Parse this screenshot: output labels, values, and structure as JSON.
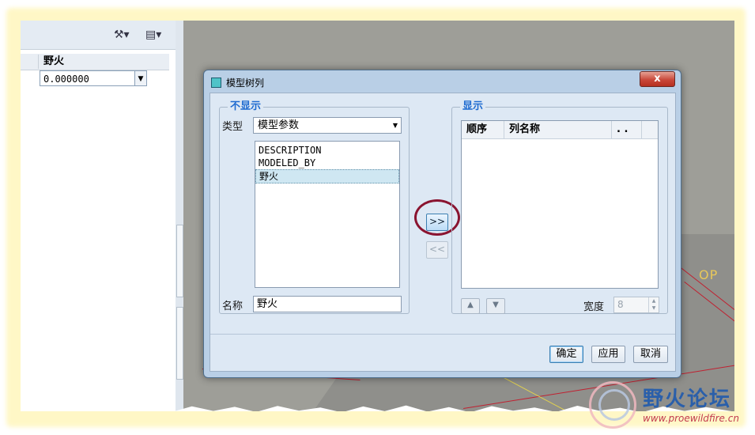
{
  "left_panel": {
    "column_header": "野火",
    "cell_value": "0.000000",
    "tools_icon": "tools-icon",
    "list_icon": "list-settings-icon"
  },
  "dialog": {
    "title": "模型树列",
    "close_label": "x",
    "not_shown": {
      "group_label": "不显示",
      "type_label": "类型",
      "type_value": "模型参数",
      "items": [
        "DESCRIPTION",
        "MODELED_BY",
        "野火"
      ],
      "selected_index": 2,
      "name_label": "名称",
      "name_value": "野火"
    },
    "move_right_label": ">>",
    "move_left_label": "<<",
    "shown": {
      "group_label": "显示",
      "columns": [
        "顺序",
        "列名称",
        ". ."
      ],
      "rows": [],
      "width_label": "宽度",
      "width_value": "8"
    },
    "buttons": {
      "ok": "确定",
      "apply": "应用",
      "cancel": "取消"
    }
  },
  "background": {
    "viewport_label": "OP"
  },
  "watermark": {
    "text": "野火论坛",
    "url": "www.proewildfire.cn"
  },
  "colors": {
    "accent": "#1f6bd0",
    "highlight_circle": "#8a1430",
    "close_button": "#c9483a"
  }
}
